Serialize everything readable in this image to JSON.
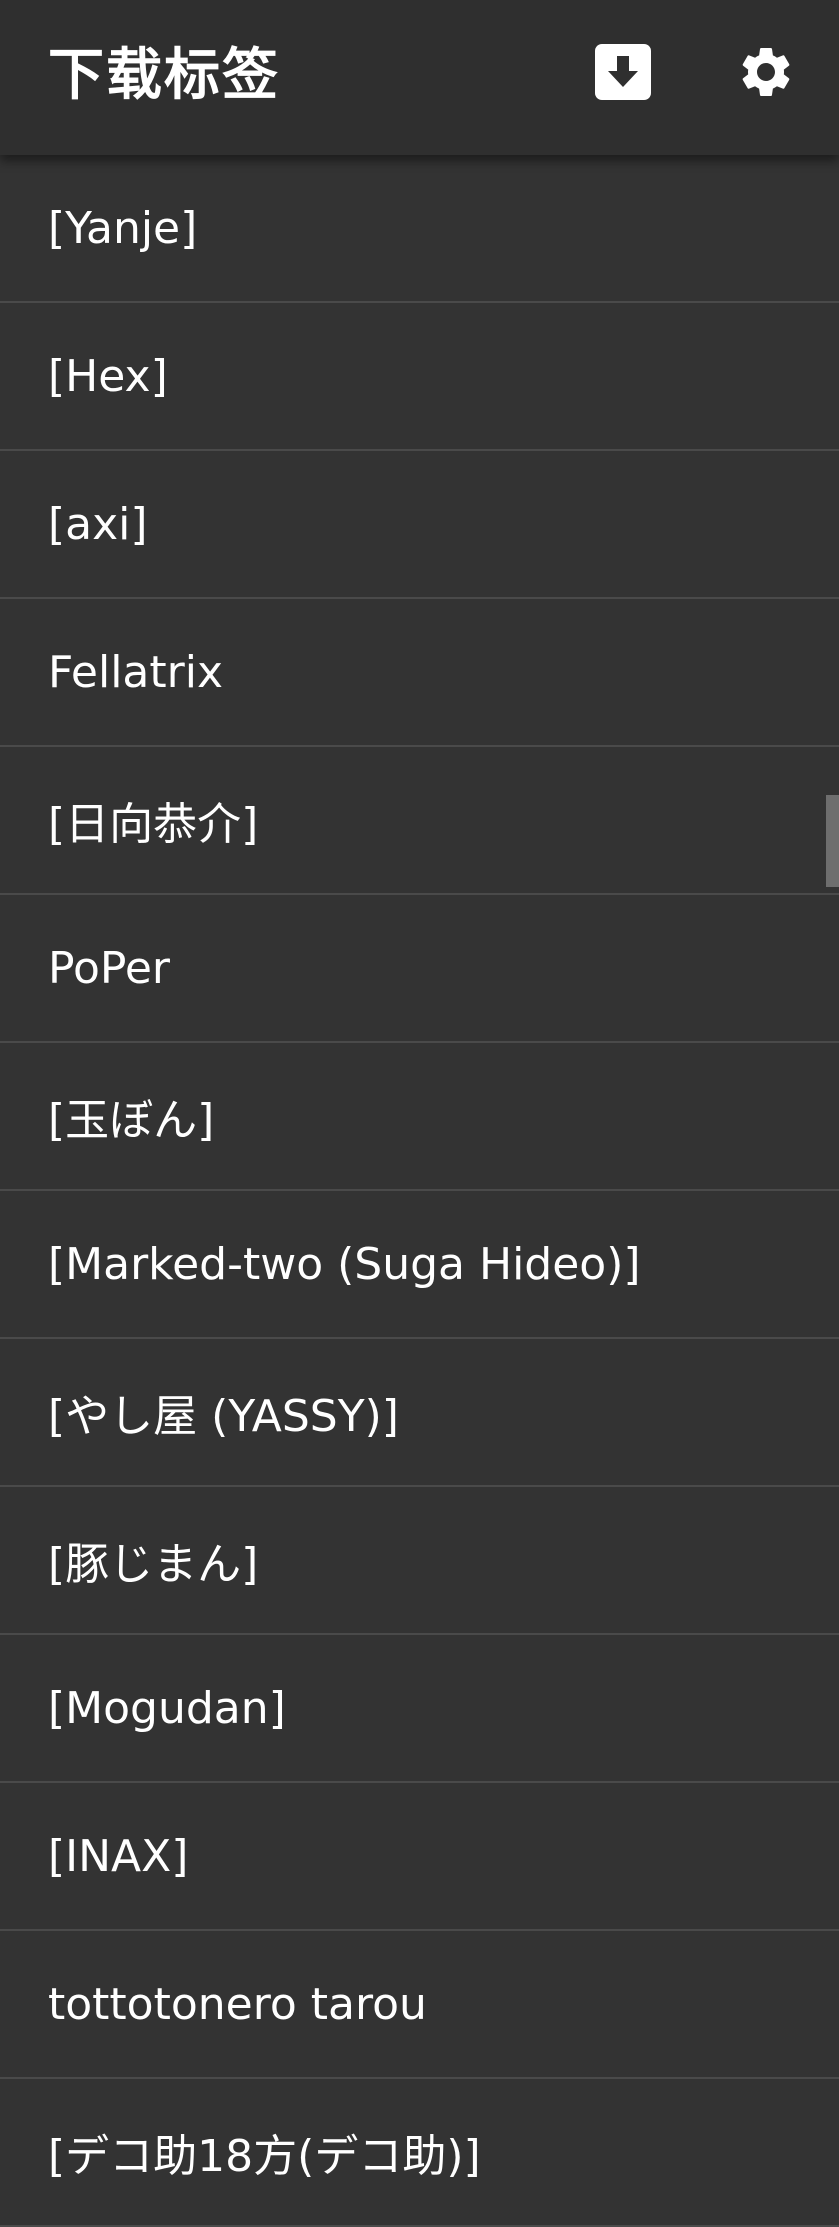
{
  "app_bar": {
    "title": "下载标签",
    "download_icon": "download-icon",
    "settings_icon": "gear-icon"
  },
  "tags": [
    {
      "label": "[Yanje]"
    },
    {
      "label": "[Hex]"
    },
    {
      "label": "[axi]"
    },
    {
      "label": "Fellatrix"
    },
    {
      "label": "[日向恭介]"
    },
    {
      "label": "PoPer"
    },
    {
      "label": "[玉ぼん]"
    },
    {
      "label": "[Marked-two (Suga Hideo)]"
    },
    {
      "label": "[やし屋 (YASSY)]"
    },
    {
      "label": "[豚じまん]"
    },
    {
      "label": "[Mogudan]"
    },
    {
      "label": "[INAX]"
    },
    {
      "label": "tottotonero tarou"
    },
    {
      "label": "[デコ助18方(デコ助)]"
    }
  ],
  "colors": {
    "background": "#333333",
    "app_bar": "#2f2f2f",
    "divider": "#4a4a4a",
    "text": "#ffffff"
  }
}
